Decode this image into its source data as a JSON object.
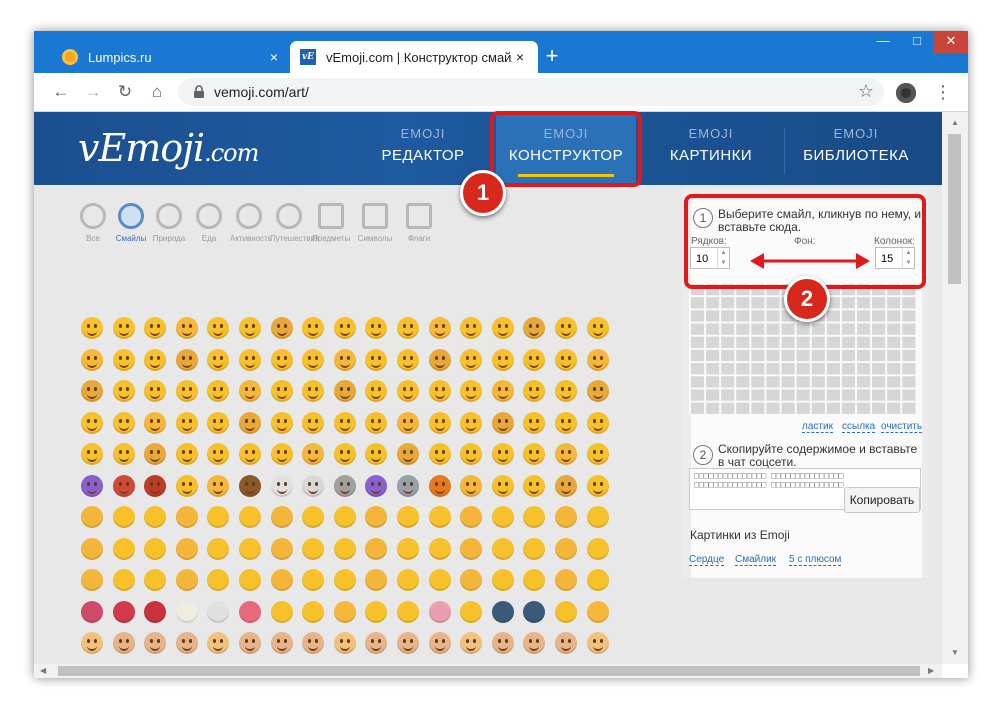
{
  "browser": {
    "tabs": [
      {
        "title": "Lumpics.ru",
        "favicon": "orange-circle-favicon",
        "active": false
      },
      {
        "title": "vEmoji.com | Конструктор смайл",
        "favicon": "vemoji-favicon",
        "active": true
      }
    ],
    "new_tab": "+",
    "close_tab": "×",
    "window_controls": {
      "minimize": "—",
      "maximize": "□",
      "close": "✕"
    },
    "url": "vemoji.com/art/",
    "icons": {
      "back": "←",
      "forward": "→",
      "reload": "↻",
      "home": "⌂",
      "star": "☆",
      "menu": "⋮"
    }
  },
  "site": {
    "logo_main": "vEmoji",
    "logo_suffix": ".com",
    "nav": [
      {
        "sup": "EMOJI",
        "label": "РЕДАКТОР"
      },
      {
        "sup": "EMOJI",
        "label": "КОНСТРУКТОР",
        "active": true
      },
      {
        "sup": "EMOJI",
        "label": "КАРТИНКИ"
      },
      {
        "sup": "EMOJI",
        "label": "БИБЛИОТЕКА"
      }
    ],
    "categories": [
      "Все",
      "Смайлы",
      "Природа",
      "Еда",
      "Активность",
      "Путешествия",
      "Предметы",
      "Символы",
      "Флаги"
    ],
    "selected_category": "Смайлы"
  },
  "panel": {
    "step1_num": "1",
    "step1_text": "Выберите смайл, кликнув по нему, и вставьте сюда.",
    "rows_label": "Рядков:",
    "rows_value": "10",
    "bg_label": "Фон:",
    "cols_label": "Колонок:",
    "cols_value": "15",
    "links": [
      "ластик",
      "ссылка",
      "очистить"
    ],
    "step2_num": "2",
    "step2_text": "Скопируйте содержимое и вставьте в чат соцсети.",
    "output_preview": "□□□□□□□□□□□□□□□ □□□□□□□□□□□□□□□ □□□□□□□□□□□□□□□ □□□□□□□□□□□□□□□",
    "copy_button": "Копировать",
    "pictures_title": "Картинки из Emoji",
    "picture_links": [
      "Сердце",
      "Смайлик",
      "5 с плюсом"
    ]
  },
  "annotations": {
    "marker1": "1",
    "marker2": "2"
  },
  "colors": {
    "accent_red": "#e0191d",
    "header_blue": "#1e5aa0",
    "link_blue": "#2c6fb5",
    "emoji_yellow": "#f7c12b"
  }
}
